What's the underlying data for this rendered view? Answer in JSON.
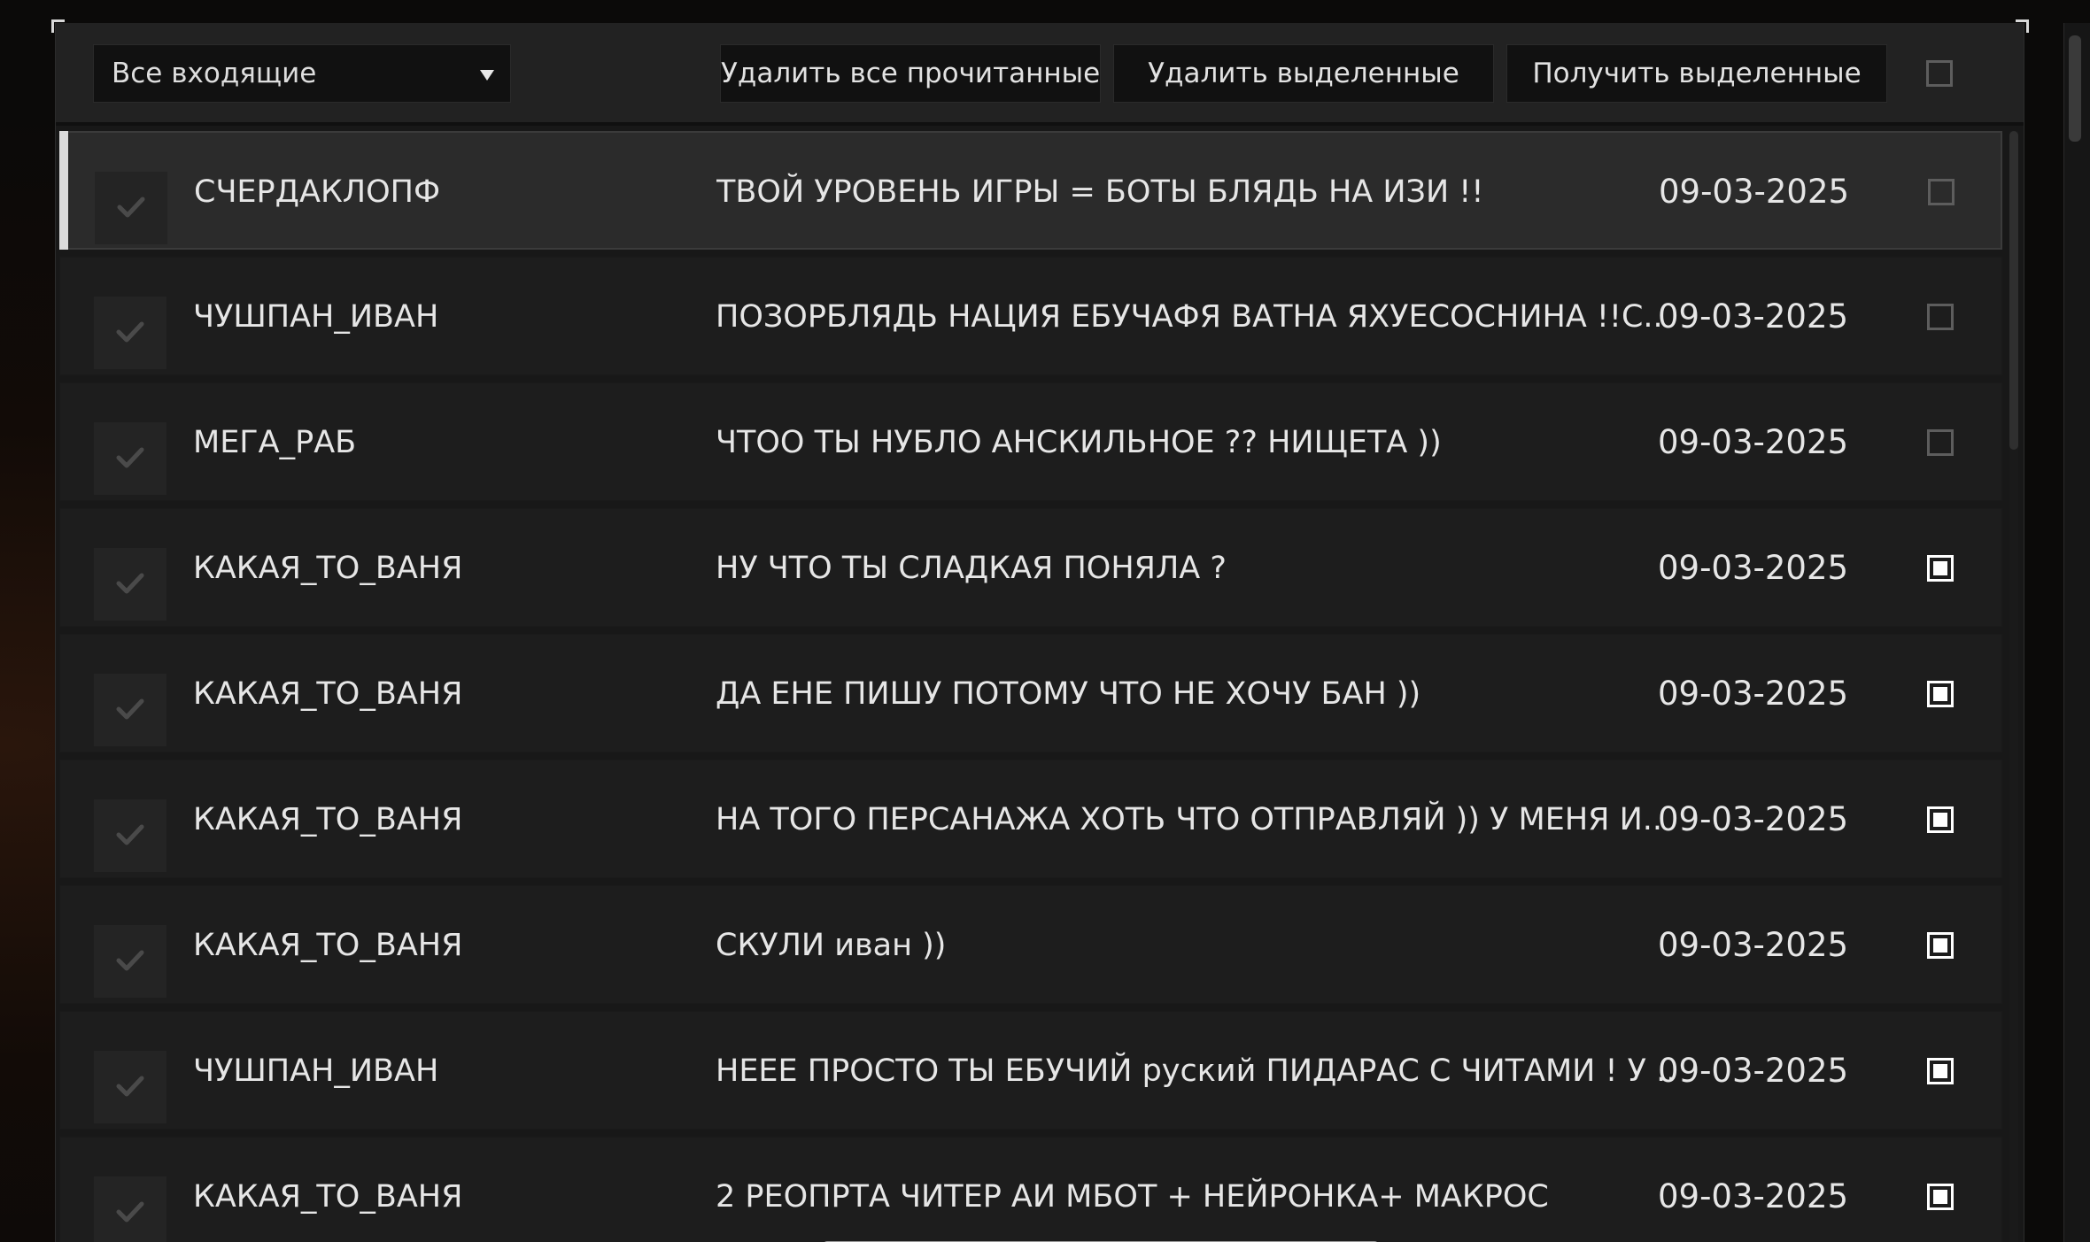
{
  "toolbar": {
    "filter_value": "Все входящие",
    "delete_read_label": "Удалить все прочитанные",
    "delete_selected_label": "Удалить выделенные",
    "get_selected_label": "Получить выделенные",
    "select_all_checked": false
  },
  "messages": [
    {
      "sender": "СЧЕРДАКЛОПФ",
      "subject": "ТВОЙ УРОВЕНЬ ИГРЫ = БОТЫ БЛЯДЬ НА ИЗИ !!",
      "date": "09-03-2025",
      "checked": false,
      "active": true
    },
    {
      "sender": "ЧУШПАН_ИВАН",
      "subject": "ПОЗОРБЛЯДЬ НАЦИЯ ЕБУЧАФЯ ВАТНА ЯХУЕСОСНИНА !!С..",
      "date": "09-03-2025",
      "checked": false,
      "active": false
    },
    {
      "sender": "МЕГА_РАБ",
      "subject": "ЧТОО ТЫ НУБЛО АНСКИЛЬНОЕ ?? НИЩЕТА ))",
      "date": "09-03-2025",
      "checked": false,
      "active": false
    },
    {
      "sender": "КАКАЯ_ТО_ВАНЯ",
      "subject": "НУ ЧТО ТЫ СЛАДКАЯ ПОНЯЛА ?",
      "date": "09-03-2025",
      "checked": true,
      "active": false
    },
    {
      "sender": "КАКАЯ_ТО_ВАНЯ",
      "subject": "ДА ЕНЕ ПИШУ ПОТОМУ ЧТО НЕ ХОЧУ БАН ))",
      "date": "09-03-2025",
      "checked": true,
      "active": false
    },
    {
      "sender": "КАКАЯ_ТО_ВАНЯ",
      "subject": "НА ТОГО ПЕРСАНАЖА ХОТЬ ЧТО ОТПРАВЛЯЙ )) У МЕНЯ И..",
      "date": "09-03-2025",
      "checked": true,
      "active": false
    },
    {
      "sender": "КАКАЯ_ТО_ВАНЯ",
      "subject": "СКУЛИ иван ))",
      "date": "09-03-2025",
      "checked": true,
      "active": false
    },
    {
      "sender": "ЧУШПАН_ИВАН",
      "subject": "НЕЕЕ ПРОСТО ТЫ ЕБУЧИЙ руский ПИДАРАС С ЧИТАМИ ! У ..",
      "date": "09-03-2025",
      "checked": true,
      "active": false
    },
    {
      "sender": "КАКАЯ_ТО_ВАНЯ",
      "subject": "2 РЕОПРТА ЧИТЕР АИ МБОТ + НЕЙРОНКА+ МАКРОС",
      "date": "09-03-2025",
      "checked": true,
      "active": false
    }
  ],
  "icons": {
    "read": "checkmark-icon",
    "dropdown": "chevron-down-icon"
  },
  "colors": {
    "panel_bg": "#181818",
    "row_bg": "#1d1d1d",
    "row_active_bg": "#2b2b2b",
    "accent": "#dcdcdc",
    "text": "#e6e6e6"
  }
}
